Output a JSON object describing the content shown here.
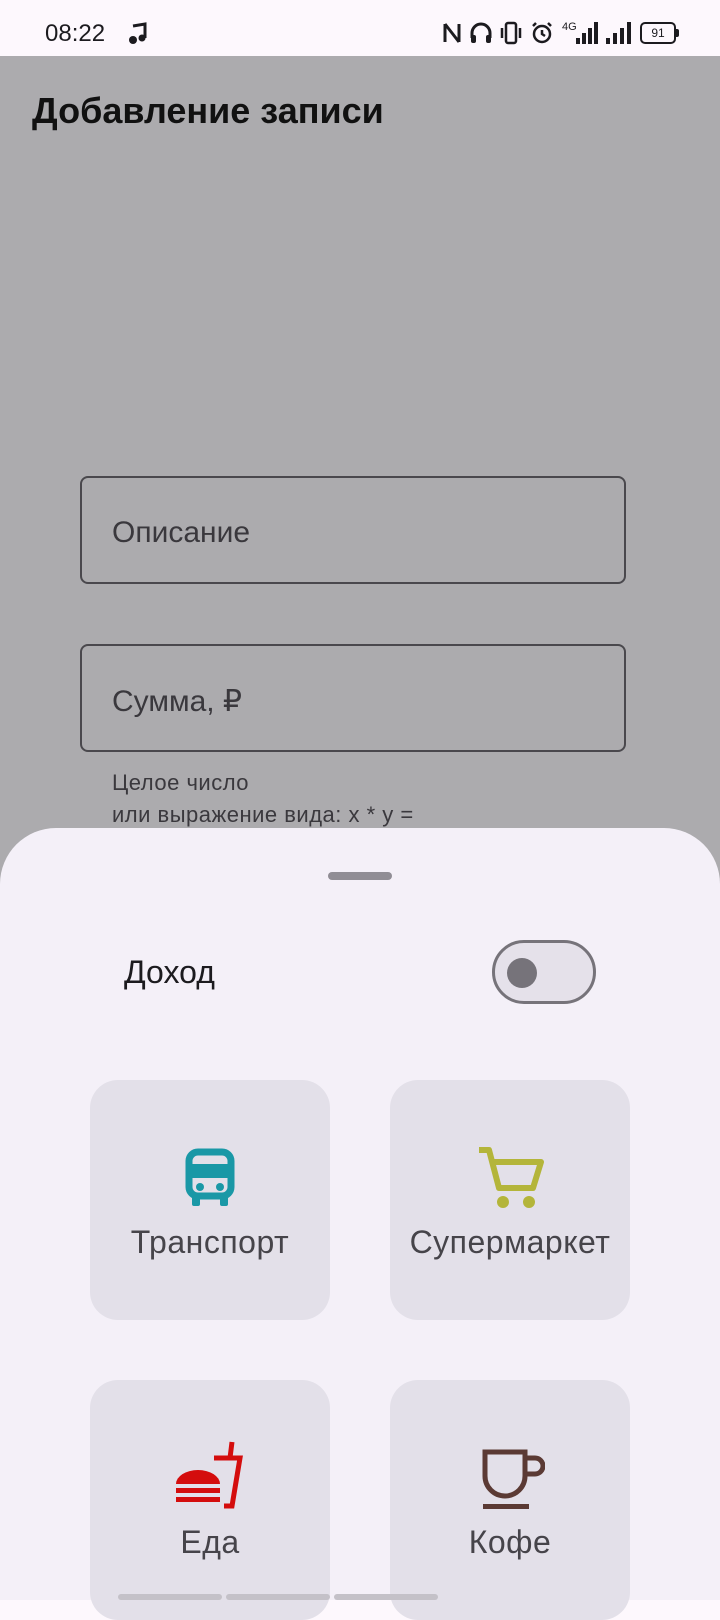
{
  "status_bar": {
    "time": "08:22",
    "battery": "91",
    "icons": [
      "music-note-icon",
      "nfc-icon",
      "headphones-icon",
      "vibrate-icon",
      "alarm-icon",
      "signal-4g-icon",
      "signal-icon",
      "battery-icon"
    ]
  },
  "screen": {
    "title": "Добавление записи",
    "description_field": {
      "label": "Описание"
    },
    "amount_field": {
      "label": "Сумма, ₽"
    },
    "amount_helper": {
      "line1": "Целое число",
      "line2": "или выражение вида: x * y ="
    }
  },
  "sheet": {
    "income_label": "Доход",
    "income_toggle": {
      "checked": false
    },
    "categories": [
      {
        "label": "Транспорт",
        "icon": "bus-icon",
        "color": "#1a98a6"
      },
      {
        "label": "Супермаркет",
        "icon": "shopping-cart-icon",
        "color": "#b4b53a"
      },
      {
        "label": "Еда",
        "icon": "fastfood-icon",
        "color": "#d40d0d"
      },
      {
        "label": "Кофе",
        "icon": "coffee-cup-icon",
        "color": "#5b3a34"
      }
    ]
  },
  "colors": {
    "scrim": "#acabae",
    "sheet_background": "#f4f0f8",
    "card_background": "#e3e0e9"
  }
}
